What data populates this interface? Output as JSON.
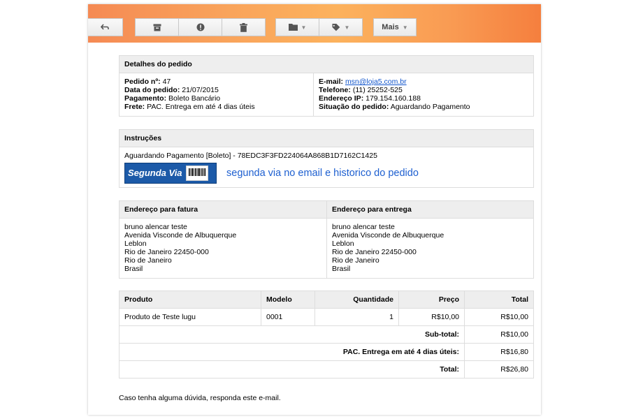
{
  "toolbar": {
    "more_label": "Mais",
    "icons": [
      "reply-icon",
      "archive-icon",
      "spam-icon",
      "trash-icon",
      "folder-icon",
      "label-icon"
    ]
  },
  "details": {
    "header": "Detalhes do pedido",
    "order_no_label": "Pedido nº:",
    "order_no": "47",
    "date_label": "Data do pedido:",
    "date": "21/07/2015",
    "payment_label": "Pagamento:",
    "payment": "Boleto Bancário",
    "shipping_label": "Frete:",
    "shipping": "PAC. Entrega em até 4 dias úteis",
    "email_label": "E-mail:",
    "email": "msn@loja5.com.br",
    "phone_label": "Telefone:",
    "phone": "(11) 25252-525",
    "ip_label": "Endereço IP:",
    "ip": "179.154.160.188",
    "status_label": "Situação do pedido:",
    "status": "Aguardando Pagamento"
  },
  "instructions": {
    "header": "Instruções",
    "text": "Aguardando Pagamento [Boleto] - 78EDC3F3FD224064A868B1D7162C1425",
    "button_label": "Segunda Via",
    "note": "segunda via no email e historico do pedido"
  },
  "addresses": {
    "billing_header": "Endereço para fatura",
    "shipping_header": "Endereço para entrega",
    "billing": [
      "bruno alencar teste",
      "Avenida Visconde de Albuquerque",
      "Leblon",
      "Rio de Janeiro 22450-000",
      "Rio de Janeiro",
      "Brasil"
    ],
    "shipping": [
      "bruno alencar teste",
      "Avenida Visconde de Albuquerque",
      "Leblon",
      "Rio de Janeiro 22450-000",
      "Rio de Janeiro",
      "Brasil"
    ]
  },
  "products": {
    "headers": {
      "product": "Produto",
      "model": "Modelo",
      "qty": "Quantidade",
      "price": "Preço",
      "total": "Total"
    },
    "rows": [
      {
        "product": "Produto de Teste lugu",
        "model": "0001",
        "qty": "1",
        "price": "R$10,00",
        "total": "R$10,00"
      }
    ],
    "totals": [
      {
        "label": "Sub-total:",
        "value": "R$10,00"
      },
      {
        "label": "PAC. Entrega em até 4 dias úteis:",
        "value": "R$16,80"
      },
      {
        "label": "Total:",
        "value": "R$26,80"
      }
    ]
  },
  "footer": "Caso tenha alguma dúvida, responda este e-mail."
}
